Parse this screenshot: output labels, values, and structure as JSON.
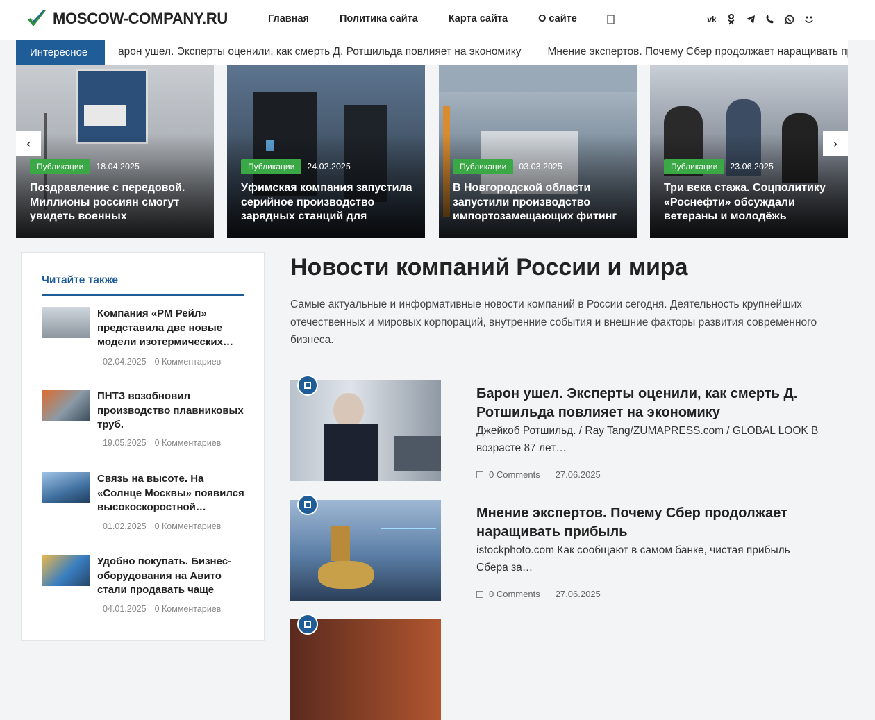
{
  "header": {
    "logo_text": "MOSCOW-COMPANY.RU",
    "nav": [
      "Главная",
      "Политика сайта",
      "Карта сайта",
      "О сайте"
    ],
    "search_icon": "search-icon",
    "socials": [
      "vk",
      "ok",
      "telegram",
      "viber",
      "whatsapp",
      "moimir"
    ]
  },
  "ticker": {
    "label": "Интересное",
    "items": [
      "арон ушел. Эксперты оценили, как смерть Д. Ротшильда повлияет на экономику",
      "Мнение экспертов. Почему Сбер продолжает наращивать прибыль"
    ]
  },
  "slider": {
    "prev": "‹",
    "next": "›",
    "slides": [
      {
        "category": "Публикации",
        "date": "18.04.2025",
        "title": "Поздравление с передовой. Миллионы россиян смогут увидеть военных"
      },
      {
        "category": "Публикации",
        "date": "24.02.2025",
        "title": "Уфимская компания запустила серийное производство зарядных станций для"
      },
      {
        "category": "Публикации",
        "date": "03.03.2025",
        "title": "В Новгородской области запустили производство импортозамещающих фитинг"
      },
      {
        "category": "Публикации",
        "date": "23.06.2025",
        "title": "Три века стажа. Соцполитику «Роснефти» обсуждали ветераны и молодёжь"
      }
    ]
  },
  "sidebar": {
    "heading": "Читайте также",
    "items": [
      {
        "title": "Компания «РМ Рейл» представила две новые модели изотермических…",
        "date": "02.04.2025",
        "comments": "0 Комментариев"
      },
      {
        "title": "ПНТЗ возобновил производство плавниковых труб.",
        "date": "19.05.2025",
        "comments": "0 Комментариев"
      },
      {
        "title": "Связь на высоте. На «Солнце Москвы» появился высокоскоростной…",
        "date": "01.02.2025",
        "comments": "0 Комментариев"
      },
      {
        "title": "Удобно покупать. Бизнес-оборудования на Авито стали продавать чаще",
        "date": "04.01.2025",
        "comments": "0 Комментариев"
      }
    ]
  },
  "main": {
    "title": "Новости компаний России и мира",
    "description": "Самые актуальные и информативные новости компаний в России сегодня. Деятельность крупнейших отечественных и мировых корпораций, внутренние события и внешние факторы развития современного бизнеса.",
    "articles": [
      {
        "title": "Барон ушел. Эксперты оценили, как смерть Д. Ротшильда повлияет на экономику",
        "excerpt": "Джейкоб Ротшильд. / Ray Tang/ZUMAPRESS.com / GLOBAL LOOK В возрасте 87 лет…",
        "comments": "0 Comments",
        "date": "27.06.2025"
      },
      {
        "title": "Мнение экспертов. Почему Сбер продолжает наращивать прибыль",
        "excerpt": "istockphoto.com Как сообщают в самом банке, чистая прибыль Сбера за…",
        "comments": "0 Comments",
        "date": "27.06.2025"
      }
    ]
  }
}
